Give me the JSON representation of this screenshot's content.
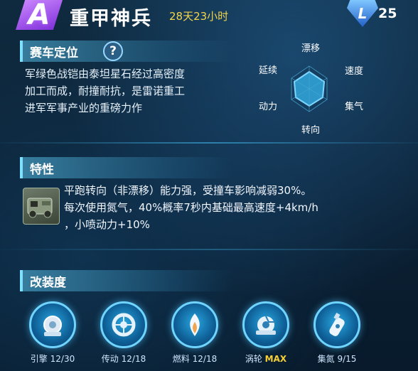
{
  "header": {
    "rank": "A",
    "car_name": "重甲神兵",
    "duration": "28天23小时",
    "level_letter": "L",
    "level": "25"
  },
  "positioning": {
    "title": "赛车定位",
    "help": "?",
    "description": [
      "军绿色战铠由泰坦星石经过高密度",
      "加工而成，耐撞耐抗，是雷诺重工",
      "进军军事产业的重磅力作"
    ]
  },
  "radar": {
    "labels": {
      "drift": "漂移",
      "extend": "延续",
      "speed": "速度",
      "power": "动力",
      "nitro": "集气",
      "turn": "转向"
    }
  },
  "traits": {
    "title": "特性",
    "lines": [
      "平跑转向（非漂移）能力强，受撞车影响减弱30%。",
      "每次使用氮气，40%概率7秒内基础最高速度+4km/h",
      "，小喷动力+10%"
    ]
  },
  "mods": {
    "title": "改装度",
    "items": [
      {
        "name": "引擎",
        "value": "12/30"
      },
      {
        "name": "传动",
        "value": "12/18"
      },
      {
        "name": "燃料",
        "value": "12/18"
      },
      {
        "name": "涡轮",
        "value": "MAX"
      },
      {
        "name": "集氮",
        "value": "9/15"
      }
    ]
  },
  "colors": {
    "accent": "#6fd4ff",
    "gold": "#f2d34c",
    "rank": "#b066ff"
  }
}
